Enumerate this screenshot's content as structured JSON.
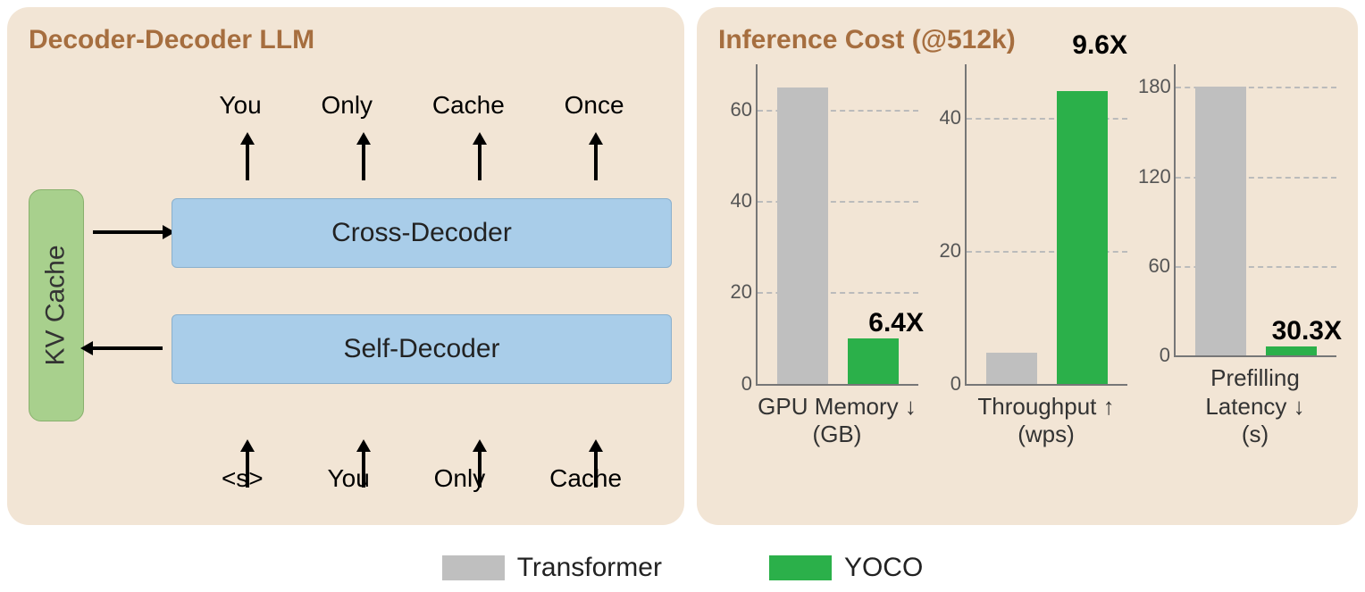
{
  "left": {
    "title": "Decoder-Decoder LLM",
    "kv_cache": "KV Cache",
    "outputs": [
      "You",
      "Only",
      "Cache",
      "Once"
    ],
    "cross_decoder": "Cross-Decoder",
    "self_decoder": "Self-Decoder",
    "inputs": [
      "<s>",
      "You",
      "Only",
      "Cache"
    ]
  },
  "right": {
    "title": "Inference Cost (@512k)"
  },
  "chart_data": [
    {
      "type": "bar",
      "title": "GPU Memory ↓\n(GB)",
      "categories": [
        "Transformer",
        "YOCO"
      ],
      "values": [
        65,
        10
      ],
      "ylim": [
        0,
        70
      ],
      "yticks": [
        0,
        20,
        40,
        60
      ],
      "annotation": "6.4X"
    },
    {
      "type": "bar",
      "title": "Throughput ↑\n(wps)",
      "categories": [
        "Transformer",
        "YOCO"
      ],
      "values": [
        4.6,
        44
      ],
      "ylim": [
        0,
        48
      ],
      "yticks": [
        0,
        20,
        40
      ],
      "annotation": "9.6X"
    },
    {
      "type": "bar",
      "title": "Prefilling Latency ↓\n(s)",
      "categories": [
        "Transformer",
        "YOCO"
      ],
      "values": [
        180,
        6
      ],
      "ylim": [
        0,
        195
      ],
      "yticks": [
        0,
        60,
        120,
        180
      ],
      "annotation": "30.3X"
    }
  ],
  "legend": {
    "transformer": "Transformer",
    "yoco": "YOCO"
  },
  "colors": {
    "panel_bg": "#f2e5d5",
    "title": "#a66e3f",
    "kv_cache": "#a8d08d",
    "block": "#a9cde9",
    "transformer": "#bfbfbf",
    "yoco": "#2bb04a"
  }
}
